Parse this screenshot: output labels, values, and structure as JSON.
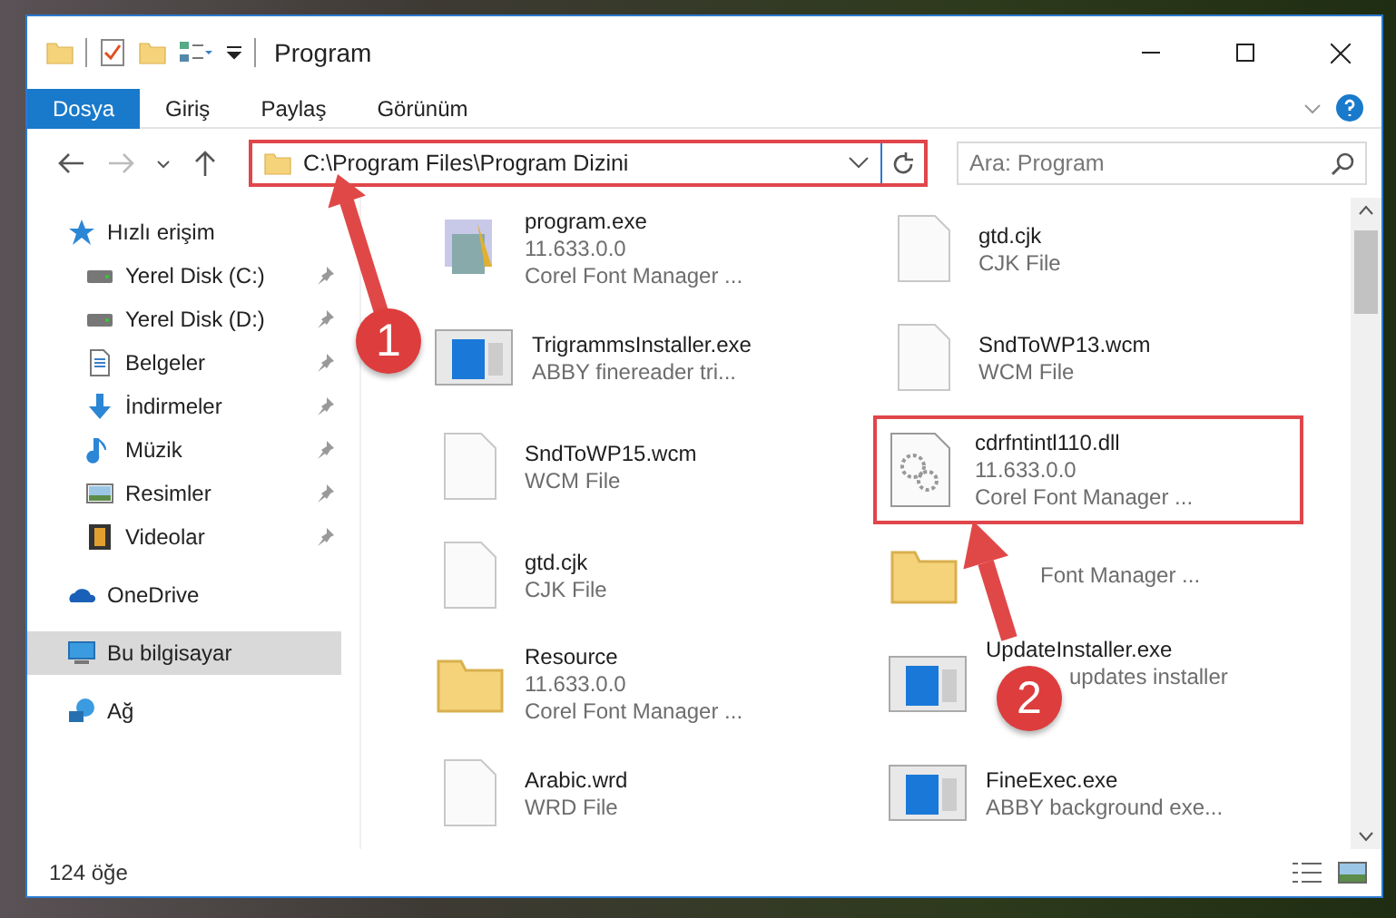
{
  "window": {
    "title": "Program"
  },
  "ribbon_tabs": [
    {
      "label": "Dosya",
      "selected": true
    },
    {
      "label": "Giriş",
      "selected": false
    },
    {
      "label": "Paylaş",
      "selected": false
    },
    {
      "label": "Görünüm",
      "selected": false
    }
  ],
  "address_bar": {
    "path": "C:\\Program Files\\Program Dizini",
    "highlighted": true
  },
  "search": {
    "placeholder": "Ara: Program"
  },
  "sidebar": {
    "items": [
      {
        "label": "Hızlı erişim",
        "kind": "star",
        "selected": false,
        "children": [
          {
            "label": "Yerel Disk (C:)",
            "kind": "drive",
            "pinned": true,
            "selected": false
          },
          {
            "label": "Yerel Disk (D:)",
            "kind": "drive",
            "pinned": true,
            "selected": false
          },
          {
            "label": "Belgeler",
            "kind": "document",
            "pinned": true,
            "selected": false
          },
          {
            "label": "İndirmeler",
            "kind": "download",
            "pinned": true,
            "selected": false
          },
          {
            "label": "Müzik",
            "kind": "music",
            "pinned": true,
            "selected": false
          },
          {
            "label": "Resimler",
            "kind": "picture",
            "pinned": true,
            "selected": false
          },
          {
            "label": "Videolar",
            "kind": "video",
            "pinned": true,
            "selected": false
          }
        ]
      },
      {
        "label": "OneDrive",
        "kind": "cloud",
        "selected": false
      },
      {
        "label": "Bu bilgisayar",
        "kind": "computer",
        "selected": true
      },
      {
        "label": "Ağ",
        "kind": "network",
        "selected": false
      }
    ]
  },
  "files": [
    {
      "name": "program.exe",
      "kind": "installer",
      "lines": [
        "11.633.0.0",
        "Corel Font Manager ..."
      ],
      "highlighted": false
    },
    {
      "name": "gtd.cjk",
      "kind": "blank",
      "lines": [
        "CJK File"
      ],
      "highlighted": false
    },
    {
      "name": "TrigrammsInstaller.exe",
      "kind": "app",
      "lines": [
        "ABBY finereader tri..."
      ],
      "highlighted": false
    },
    {
      "name": "SndToWP13.wcm",
      "kind": "blank",
      "lines": [
        "WCM File"
      ],
      "highlighted": false
    },
    {
      "name": "SndToWP15.wcm",
      "kind": "blank",
      "lines": [
        "WCM File"
      ],
      "highlighted": false
    },
    {
      "name": "cdrfntintl110.dll",
      "kind": "dll",
      "lines": [
        "11.633.0.0",
        "Corel Font Manager ..."
      ],
      "highlighted": true
    },
    {
      "name": "gtd.cjk",
      "kind": "blank",
      "lines": [
        "CJK File"
      ],
      "highlighted": false
    },
    {
      "kind": "folder",
      "lines": [
        "Font Manager ..."
      ],
      "highlighted": false
    },
    {
      "name": "Resource",
      "kind": "folder",
      "lines": [
        "11.633.0.0",
        "Corel Font Manager ..."
      ],
      "highlighted": false
    },
    {
      "name": "UpdateInstaller.exe",
      "kind": "app",
      "lines": [
        "updates installer"
      ],
      "step_badge": "2",
      "highlighted": false
    },
    {
      "name": "Arabic.wrd",
      "kind": "blank",
      "lines": [
        "WRD File"
      ],
      "highlighted": false
    },
    {
      "name": "FineExec.exe",
      "kind": "app",
      "lines": [
        "ABBY background exe..."
      ],
      "highlighted": false
    }
  ],
  "status_bar": {
    "count": "124 öğe"
  },
  "annotations": [
    {
      "number": "1"
    }
  ]
}
